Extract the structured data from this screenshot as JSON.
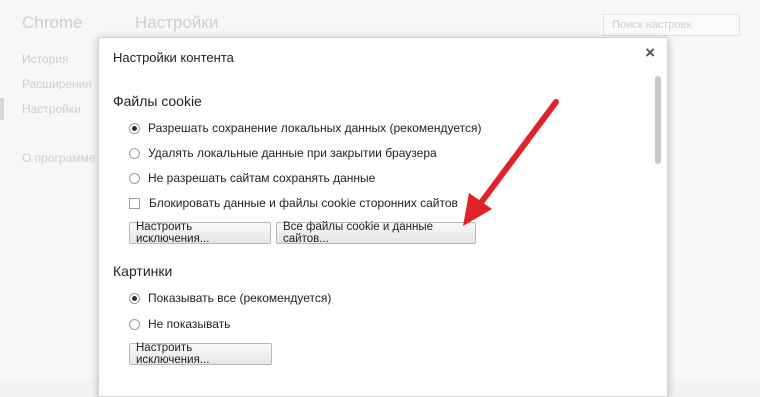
{
  "background": {
    "brand": "Chrome",
    "title": "Настройки",
    "search_placeholder": "Поиск настроек",
    "nav": [
      {
        "label": "История"
      },
      {
        "label": "Расширения"
      },
      {
        "label": "Настройки"
      },
      {
        "label": "О программе"
      }
    ]
  },
  "dialog": {
    "title": "Настройки контента",
    "close_label": "×",
    "cookies": {
      "heading": "Файлы cookie",
      "options": [
        {
          "label": "Разрешать сохранение локальных данных (рекомендуется)",
          "selected": true
        },
        {
          "label": "Удалять локальные данные при закрытии браузера",
          "selected": false
        },
        {
          "label": "Не разрешать сайтам сохранять данные",
          "selected": false
        }
      ],
      "checkbox_label": "Блокировать данные и файлы cookie сторонних сайтов",
      "checkbox_checked": false,
      "exceptions_button": "Настроить исключения...",
      "all_cookies_button": "Все файлы cookie и данные сайтов..."
    },
    "images": {
      "heading": "Картинки",
      "options": [
        {
          "label": "Показывать все (рекомендуется)",
          "selected": true
        },
        {
          "label": "Не показывать",
          "selected": false
        }
      ],
      "exceptions_button": "Настроить исключения..."
    }
  },
  "colors": {
    "annotation_arrow": "#e0232a"
  }
}
